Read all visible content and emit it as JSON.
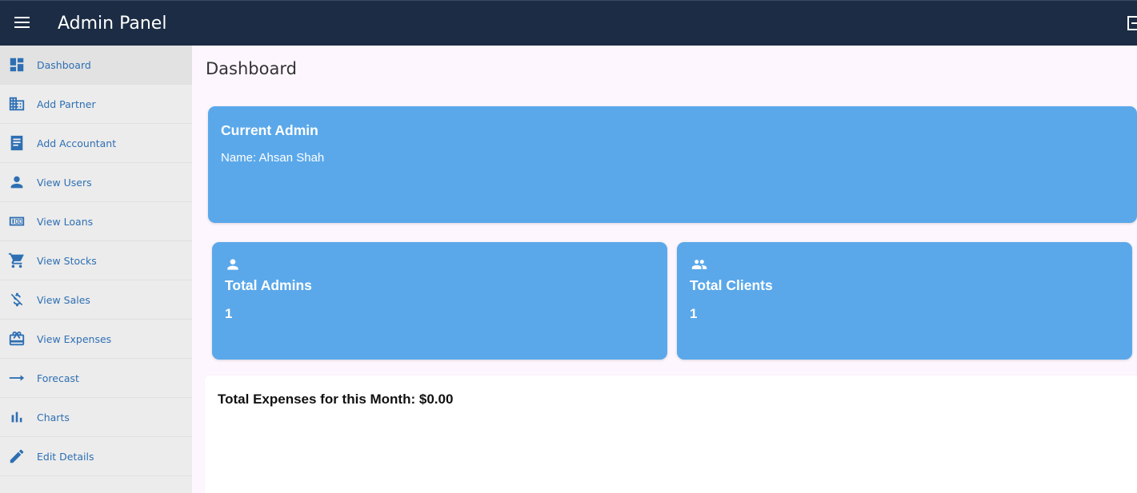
{
  "header": {
    "title": "Admin Panel",
    "menu_icon": "menu-icon",
    "logout_icon": "logout-icon"
  },
  "sidebar": {
    "items": [
      {
        "label": "Dashboard",
        "icon": "dashboard-icon",
        "active": true
      },
      {
        "label": "Add Partner",
        "icon": "business-icon"
      },
      {
        "label": "Add Accountant",
        "icon": "receipt-icon"
      },
      {
        "label": "View Users",
        "icon": "person-icon"
      },
      {
        "label": "View Loans",
        "icon": "money-icon"
      },
      {
        "label": "View Stocks",
        "icon": "cart-icon"
      },
      {
        "label": "View Sales",
        "icon": "money-off-icon"
      },
      {
        "label": "View Expenses",
        "icon": "card-giftcard-icon"
      },
      {
        "label": "Forecast",
        "icon": "arrow-right-icon"
      },
      {
        "label": "Charts",
        "icon": "bar-chart-icon"
      },
      {
        "label": "Edit Details",
        "icon": "edit-icon"
      }
    ]
  },
  "main": {
    "page_title": "Dashboard",
    "current_admin": {
      "title": "Current Admin",
      "name": "Name: Ahsan Shah"
    },
    "stats": [
      {
        "title": "Total Admins",
        "value": "1",
        "icon": "person-icon"
      },
      {
        "title": "Total Clients",
        "value": "1",
        "icon": "people-icon"
      }
    ],
    "expenses_text": "Total Expenses for this Month: $0.00"
  },
  "colors": {
    "topbar": "#1b2c44",
    "card": "#5aa8ea",
    "link": "#2e6fb3",
    "page_bg": "#fdf6fe"
  }
}
